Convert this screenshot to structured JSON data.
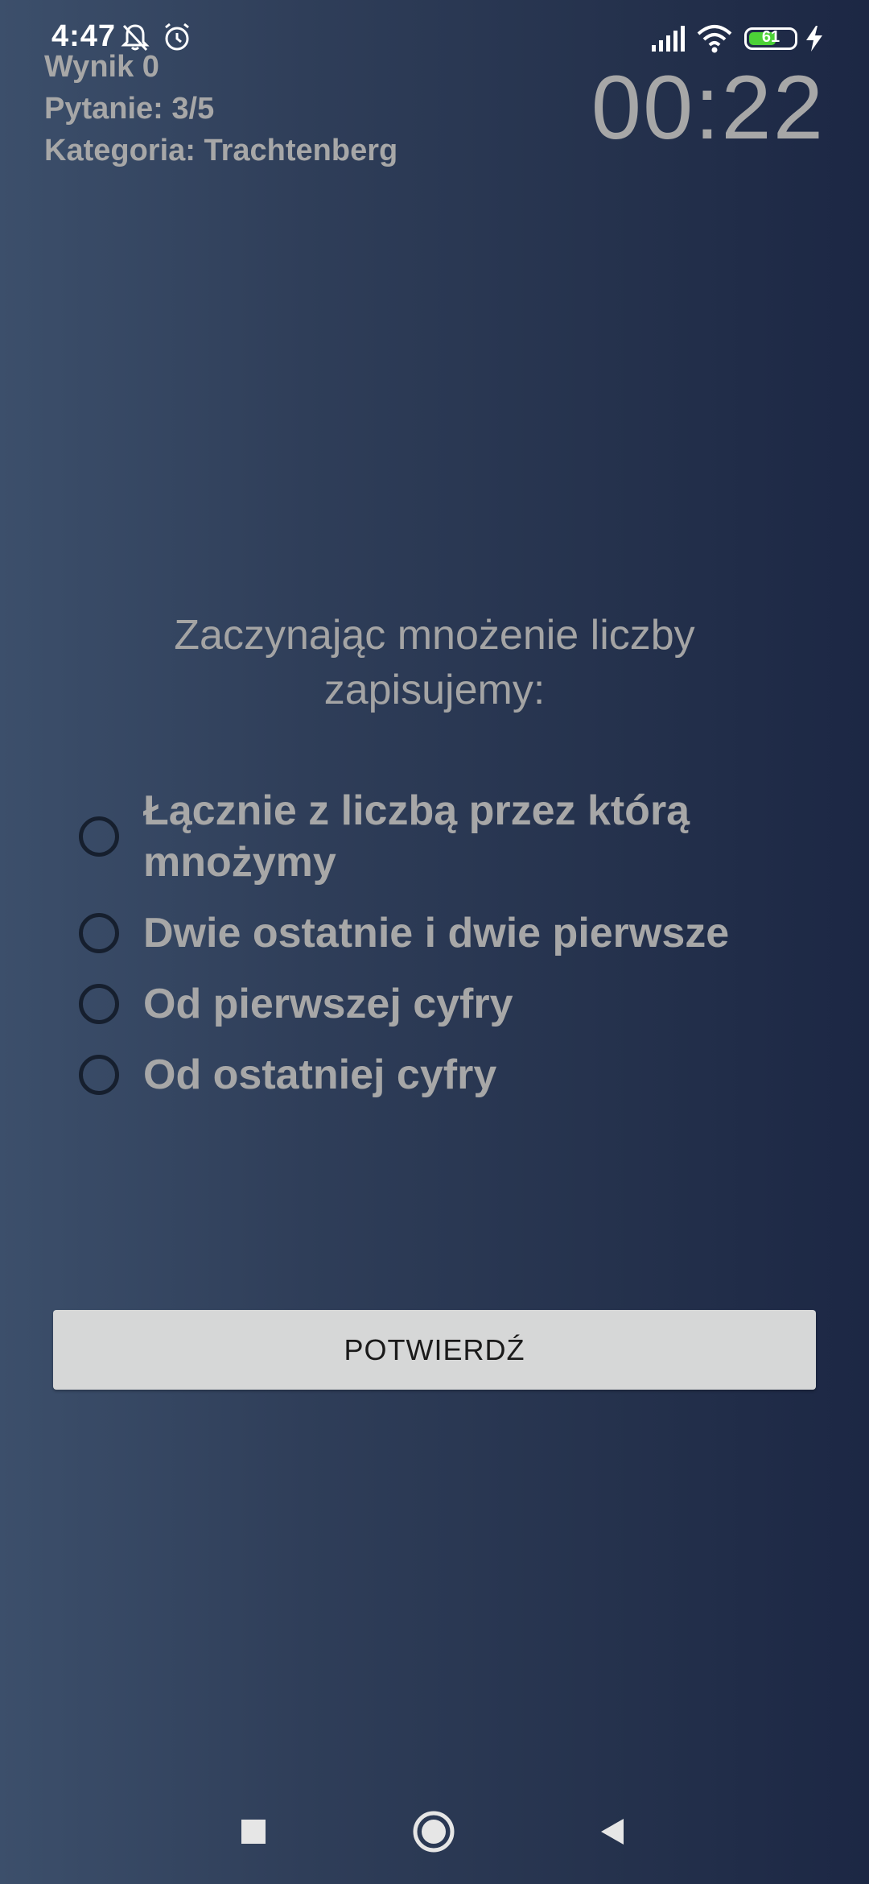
{
  "status_bar": {
    "time": "4:47",
    "battery_level": 61,
    "battery_label": "61",
    "icons": [
      "muted-bell-icon",
      "alarm-icon",
      "signal-icon",
      "wifi-icon",
      "battery-icon",
      "charging-icon"
    ]
  },
  "game": {
    "score": "Wynik 0",
    "question_counter": "Pytanie: 3/5",
    "category": "Kategoria: Trachtenberg",
    "timer": "00:22"
  },
  "question": {
    "text": "Zaczynając mnożenie liczby zapisujemy:",
    "answers": [
      {
        "label": "Łącznie z liczbą przez którą mnożymy",
        "selected": false
      },
      {
        "label": "Dwie ostatnie i dwie pierwsze",
        "selected": false
      },
      {
        "label": "Od pierwszej cyfry",
        "selected": false
      },
      {
        "label": "Od ostatniej cyfry",
        "selected": false
      }
    ]
  },
  "actions": {
    "confirm_label": "POTWIERDŹ"
  },
  "nav": {
    "icons": [
      "recents-square-icon",
      "home-circle-icon",
      "back-triangle-icon"
    ]
  },
  "colors": {
    "background_start": "#3c4f6b",
    "background_end": "#1c2744",
    "text": "#a7a7a7",
    "button": "#d6d7d7",
    "battery_fill": "#4cd137"
  }
}
